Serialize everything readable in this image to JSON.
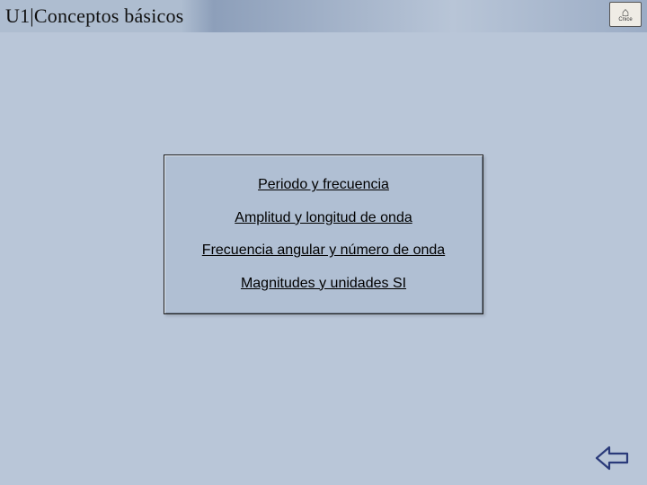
{
  "header": {
    "title": "U1|Conceptos básicos",
    "logo_label": "Cnice"
  },
  "menu": {
    "items": [
      {
        "label": "Periodo y frecuencia"
      },
      {
        "label": "Amplitud y longitud de onda"
      },
      {
        "label": "Frecuencia angular y número de onda"
      },
      {
        "label": "Magnitudes y unidades SI"
      }
    ]
  },
  "nav": {
    "back_icon": "back-arrow"
  }
}
